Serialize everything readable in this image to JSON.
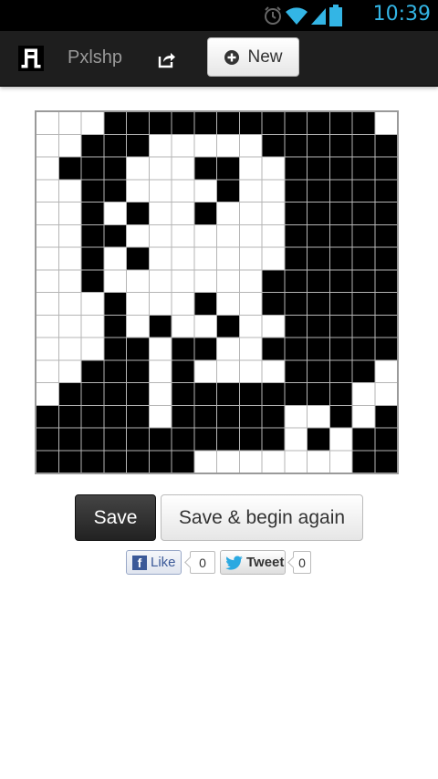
{
  "status_bar": {
    "time": "10:39",
    "icons": [
      "alarm-icon",
      "wifi-icon",
      "signal-icon",
      "battery-icon"
    ]
  },
  "app_bar": {
    "brand_name": "Pxlshp",
    "share_icon": "share-icon",
    "new_button_label": "New",
    "new_button_icon": "plus-circle-icon"
  },
  "pixel_grid": {
    "rows": 16,
    "cols": 16,
    "on_color": "#000000",
    "off_color": "#ffffff",
    "cells": [
      "0001111111111110",
      "0011100000111111",
      "0111000110011111",
      "0011000010011111",
      "0010100100011111",
      "0011000000011111",
      "0010100000011111",
      "0010000000111111",
      "0001000100111111",
      "0001010010011111",
      "0001101100111111",
      "0011101000011110",
      "0111101111111100",
      "1111101111100101",
      "1111111111101011",
      "1111111000000011"
    ]
  },
  "actions": {
    "save_label": "Save",
    "save_again_label": "Save & begin again"
  },
  "social": {
    "like_label": "Like",
    "like_count": "0",
    "tweet_label": "Tweet",
    "tweet_count": "0"
  }
}
